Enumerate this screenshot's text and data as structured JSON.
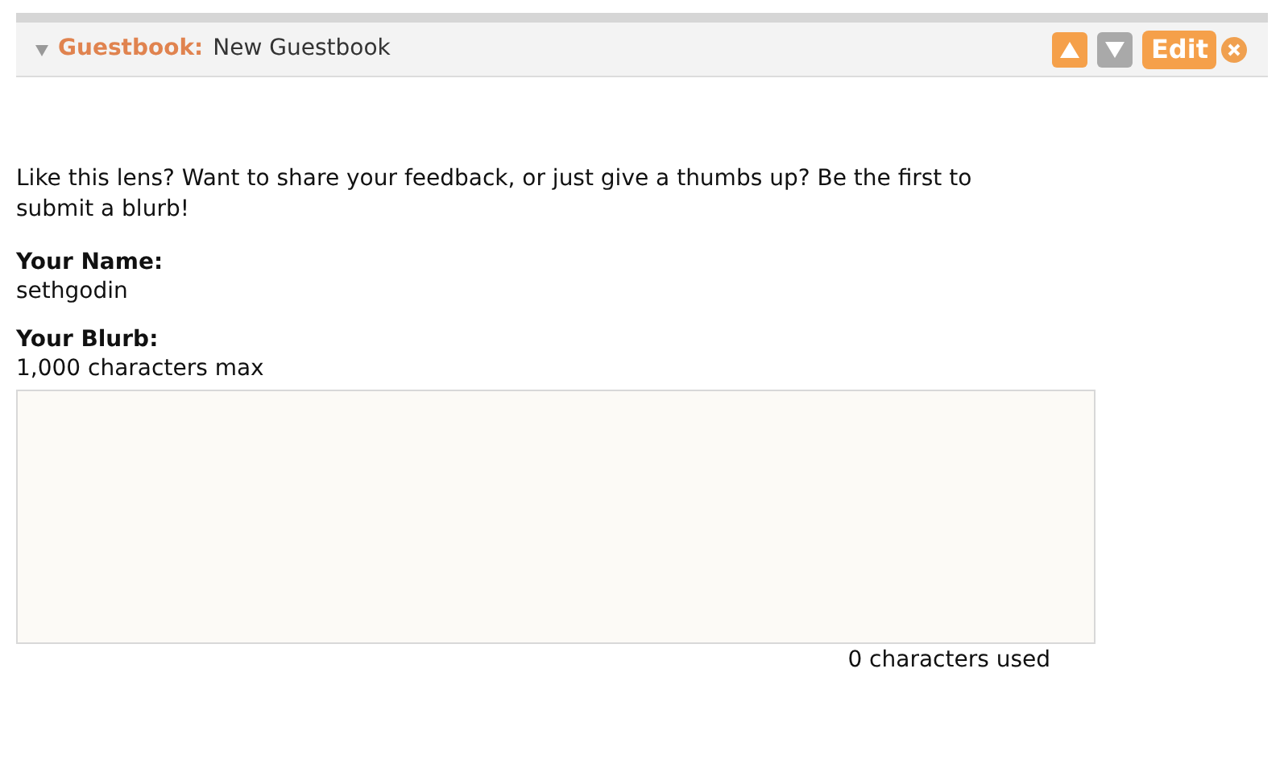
{
  "header": {
    "module_type": "Guestbook:",
    "module_name": "New Guestbook",
    "expanded": true,
    "move_up_enabled": true,
    "move_down_enabled": false,
    "edit_label": "Edit"
  },
  "intro": "Like this lens? Want to share your feedback, or just give a thumbs up? Be the first to submit a blurb!",
  "name_field": {
    "label": "Your Name:",
    "value": "sethgodin"
  },
  "blurb_field": {
    "label": "Your Blurb:",
    "hint": "1,000 characters max",
    "counter": "0 characters used"
  }
}
